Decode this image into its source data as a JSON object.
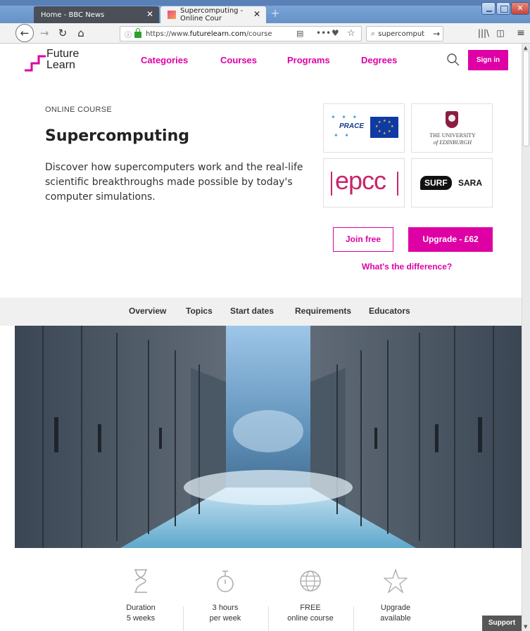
{
  "browser": {
    "tabs": [
      {
        "label": "Home - BBC News",
        "active": false
      },
      {
        "label": "Supercomputing - Online Cour",
        "active": true
      }
    ],
    "new_tab_icon": "+",
    "url_prefix": "https://www.",
    "url_host": "futurelearn.com",
    "url_path": "/courses/",
    "search_value": "supercomput",
    "icons": [
      "back-icon",
      "forward-icon",
      "reload-icon",
      "home-icon",
      "lock-icon",
      "reader-icon",
      "more-icon",
      "pocket-icon",
      "bookmark-star-icon",
      "search-icon",
      "library-icon",
      "sidebar-icon",
      "menu-icon"
    ]
  },
  "header": {
    "logo_line1": "Future",
    "logo_line2": "Learn",
    "nav": [
      "Categories",
      "Courses",
      "Programs",
      "Degrees"
    ],
    "sign_in": "Sign in",
    "accent_color": "#de00a5"
  },
  "course": {
    "label": "ONLINE COURSE",
    "title": "Supercomputing",
    "description": "Discover how supercomputers work and the real-life scientific breakthroughs made possible by today's computer simulations."
  },
  "partners": {
    "prace": "PRACE",
    "edinburgh_line1": "THE UNIVERSITY",
    "edinburgh_line2": "of EDINBURGH",
    "epcc": "epcc",
    "surf": "SURF",
    "sara": "SARA"
  },
  "actions": {
    "join": "Join free",
    "upgrade": "Upgrade - £62",
    "difference": "What's the difference?"
  },
  "subnav": [
    "Overview",
    "Topics",
    "Start dates",
    "Requirements",
    "Educators"
  ],
  "stats": [
    {
      "icon": "hourglass-icon",
      "line1": "Duration",
      "line2": "5 weeks"
    },
    {
      "icon": "stopwatch-icon",
      "line1": "3 hours",
      "line2": "per week"
    },
    {
      "icon": "globe-icon",
      "line1": "FREE",
      "line2": "online course"
    },
    {
      "icon": "star-icon",
      "line1": "Upgrade",
      "line2": "available"
    }
  ],
  "support": "Support"
}
